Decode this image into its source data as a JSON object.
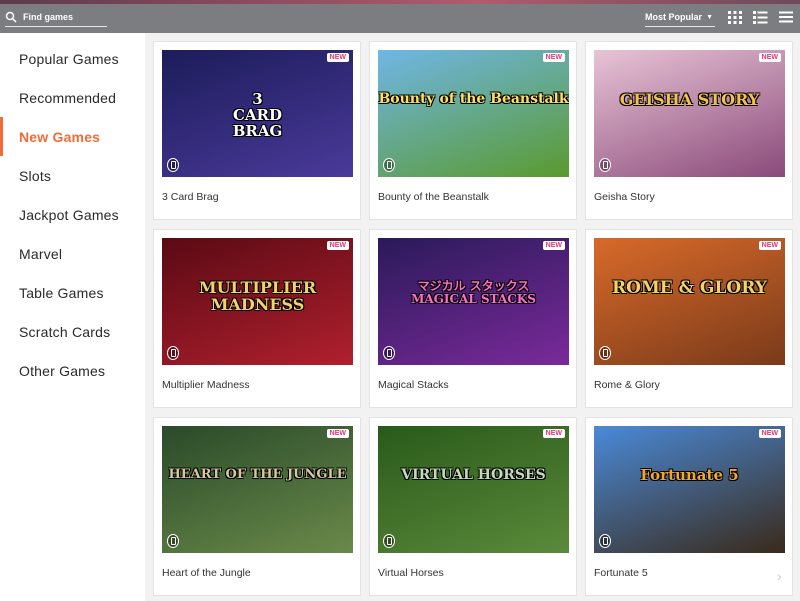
{
  "search": {
    "placeholder": "Find games"
  },
  "sort": {
    "selected": "Most Popular"
  },
  "view_buttons": [
    "grid-view-icon",
    "list-view-icon",
    "menu-icon"
  ],
  "sidebar": {
    "items": [
      {
        "label": "Popular Games",
        "active": false
      },
      {
        "label": "Recommended",
        "active": false
      },
      {
        "label": "New Games",
        "active": true
      },
      {
        "label": "Slots",
        "active": false
      },
      {
        "label": "Jackpot Games",
        "active": false
      },
      {
        "label": "Marvel",
        "active": false
      },
      {
        "label": "Table Games",
        "active": false
      },
      {
        "label": "Scratch Cards",
        "active": false
      },
      {
        "label": "Other Games",
        "active": false
      }
    ]
  },
  "games": [
    {
      "name": "3 Card Brag",
      "art": "3\nCARD\nBRAG",
      "badge": "NEW",
      "bg": [
        "#1c1c5a",
        "#4a3a9a"
      ],
      "text": "#ffffff"
    },
    {
      "name": "Bounty of the Beanstalk",
      "art": "Bounty of the Beanstalk",
      "badge": "NEW",
      "bg": [
        "#6fb6e6",
        "#5a9a2e"
      ],
      "text": "#ffe066"
    },
    {
      "name": "Geisha Story",
      "art": "GEISHA STORY",
      "badge": "NEW",
      "bg": [
        "#e8c4d6",
        "#8a4a7a"
      ],
      "text": "#f2c14e"
    },
    {
      "name": "Multiplier Madness",
      "art": "MULTIPLIER\nMADNESS",
      "badge": "NEW",
      "bg": [
        "#5a0a14",
        "#b0202e"
      ],
      "text": "#f2d26a"
    },
    {
      "name": "Magical Stacks",
      "art": "マジカル スタックス\nMAGICAL STACKS",
      "badge": "NEW",
      "bg": [
        "#2a1a5a",
        "#7a2a9a"
      ],
      "text": "#ff6ec7"
    },
    {
      "name": "Rome & Glory",
      "art": "ROME & GLORY",
      "badge": "NEW",
      "bg": [
        "#d86a2a",
        "#7a3a1a"
      ],
      "text": "#f2d26a"
    },
    {
      "name": "Heart of the Jungle",
      "art": "HEART OF THE JUNGLE",
      "badge": "NEW",
      "bg": [
        "#2a4a2a",
        "#6a8a4a"
      ],
      "text": "#d8c8a0"
    },
    {
      "name": "Virtual Horses",
      "art": "VIRTUAL HORSES",
      "badge": "NEW",
      "bg": [
        "#2a5a1a",
        "#5a8a3a"
      ],
      "text": "#c8d8c0"
    },
    {
      "name": "Fortunate 5",
      "art": "Fortunate 5",
      "badge": "NEW",
      "bg": [
        "#4a8ad8",
        "#3a2a1a"
      ],
      "text": "#f2a62a"
    }
  ],
  "colors": {
    "accent": "#f26b38",
    "badge": "#e8336f",
    "topbar": "#7b7d80"
  }
}
